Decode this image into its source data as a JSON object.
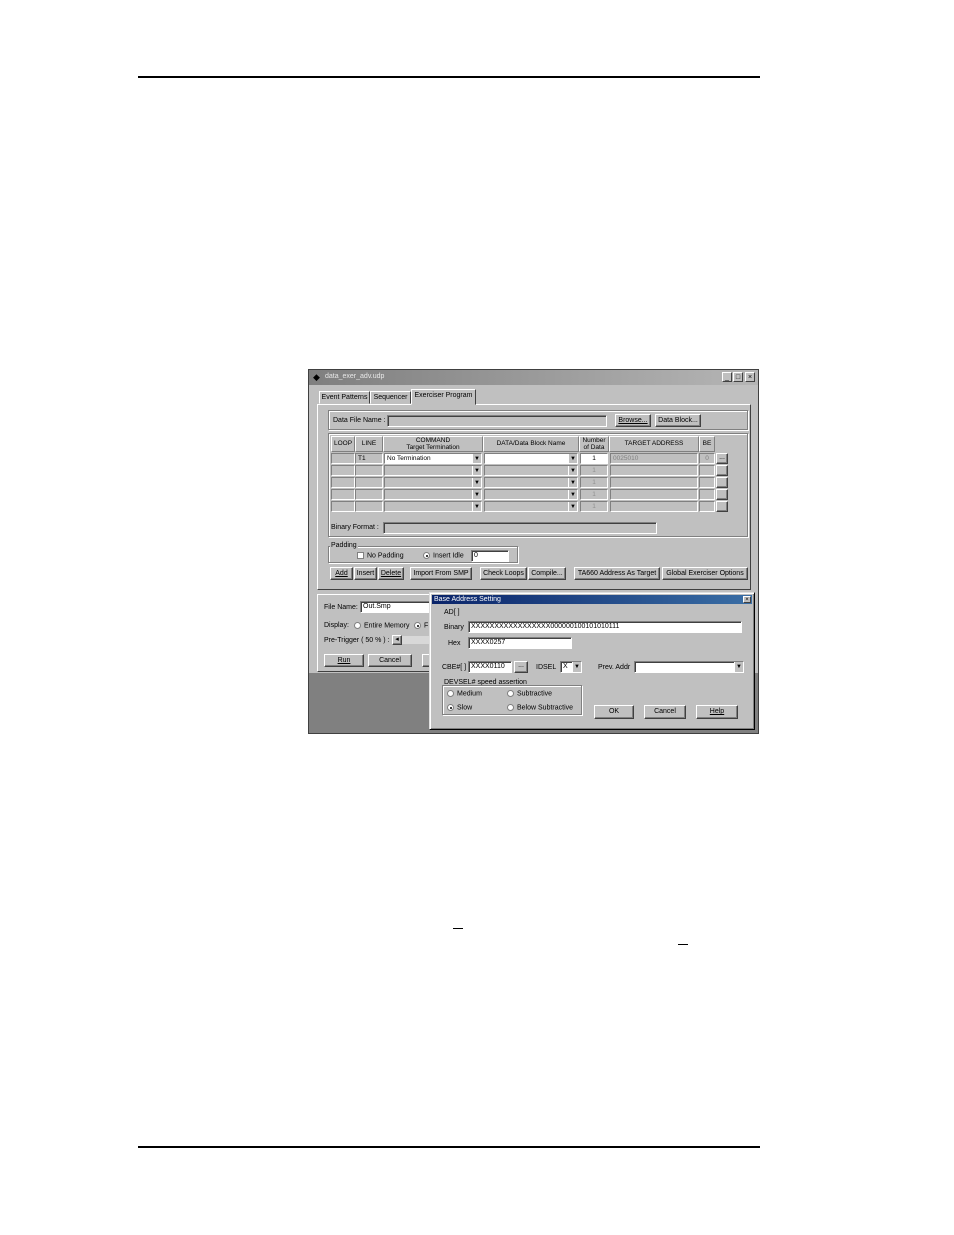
{
  "window": {
    "title": "data_exer_adv.udp",
    "minimize": "_",
    "maximize": "□",
    "close": "×"
  },
  "tabs": [
    {
      "label": "Event Patterns"
    },
    {
      "label": "Sequencer"
    },
    {
      "label": "Exerciser Program"
    }
  ],
  "data_file": {
    "label": "Data File Name :",
    "value": "",
    "browse": "Browse...",
    "data_block": "Data Block..."
  },
  "grid": {
    "headers": {
      "loop": "LOOP",
      "line": "LINE",
      "command": "COMMAND",
      "target_termination": "Target Termination",
      "data_block_name": "DATA/Data Block Name",
      "number_of_data_1": "Number",
      "number_of_data_2": "of Data",
      "target_address": "TARGET ADDRESS",
      "be": "BE"
    },
    "row1": {
      "line": "T1",
      "command": "No Termination",
      "count": "1",
      "address": "0025010",
      "be": "0",
      "more": "..."
    },
    "empty_count": "1"
  },
  "binary_format": {
    "label": "Binary Format :",
    "value": ""
  },
  "padding": {
    "label": "Padding",
    "no_padding": "No Padding",
    "insert_idle": "Insert Idle",
    "idle_value": "0"
  },
  "actions": {
    "add": "Add",
    "insert": "Insert",
    "delete": "Delete",
    "import_smp": "Import From SMP",
    "check_loops": "Check Loops",
    "compile": "Compile...",
    "ta660": "TA660 Address As Target",
    "global_options": "Global Exerciser Options"
  },
  "lower": {
    "file_name_label": "File Name:",
    "file_name_value": "Out.Smp",
    "display_label": "Display:",
    "entire_memory": "Entire Memory",
    "display_other": "F",
    "pretrigger_label": "Pre-Trigger ( 50 % ) :",
    "run": "Run",
    "cancel": "Cancel"
  },
  "dialog": {
    "title": "Base Address Setting",
    "close": "×",
    "ad_label": "AD[ ]",
    "binary_label": "Binary",
    "binary_value": "XXXXXXXXXXXXXXXXX000000100101010111",
    "hex_label": "Hex",
    "hex_value": "XXXX0257",
    "cbe_label": "CBE#[ ]",
    "cbe_value": "XXXX0110",
    "cbe_btn": "...",
    "idsel_label": "IDSEL",
    "idsel_value": "X",
    "prev_addr_label": "Prev. Addr",
    "prev_addr_value": "",
    "devsel_label": "DEVSEL#  speed  assertion",
    "medium": "Medium",
    "subtractive": "Subtractive",
    "slow": "Slow",
    "below_subtractive": "Below Subtractive",
    "ok": "OK",
    "cancel": "Cancel",
    "help": "Help"
  }
}
